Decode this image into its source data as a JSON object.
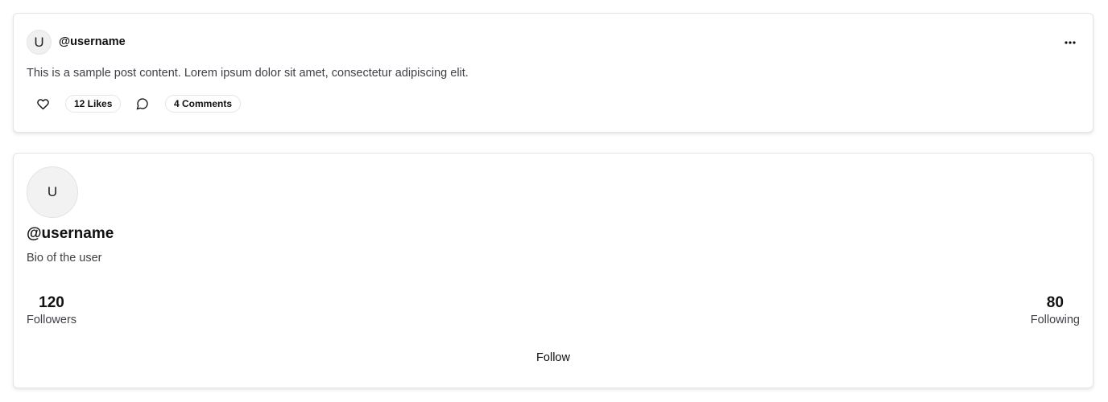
{
  "post": {
    "avatar_initial": "U",
    "username": "@username",
    "more_icon": "more-horizontal-icon",
    "content": "This is a sample post content. Lorem ipsum dolor sit amet, consectetur adipiscing elit.",
    "like_icon": "heart-icon",
    "likes_label": "12 Likes",
    "comment_icon": "message-circle-icon",
    "comments_label": "4 Comments"
  },
  "profile": {
    "avatar_initial": "U",
    "username": "@username",
    "bio": "Bio of the user",
    "followers": {
      "value": "120",
      "label": "Followers"
    },
    "following": {
      "value": "80",
      "label": "Following"
    },
    "follow_label": "Follow"
  }
}
